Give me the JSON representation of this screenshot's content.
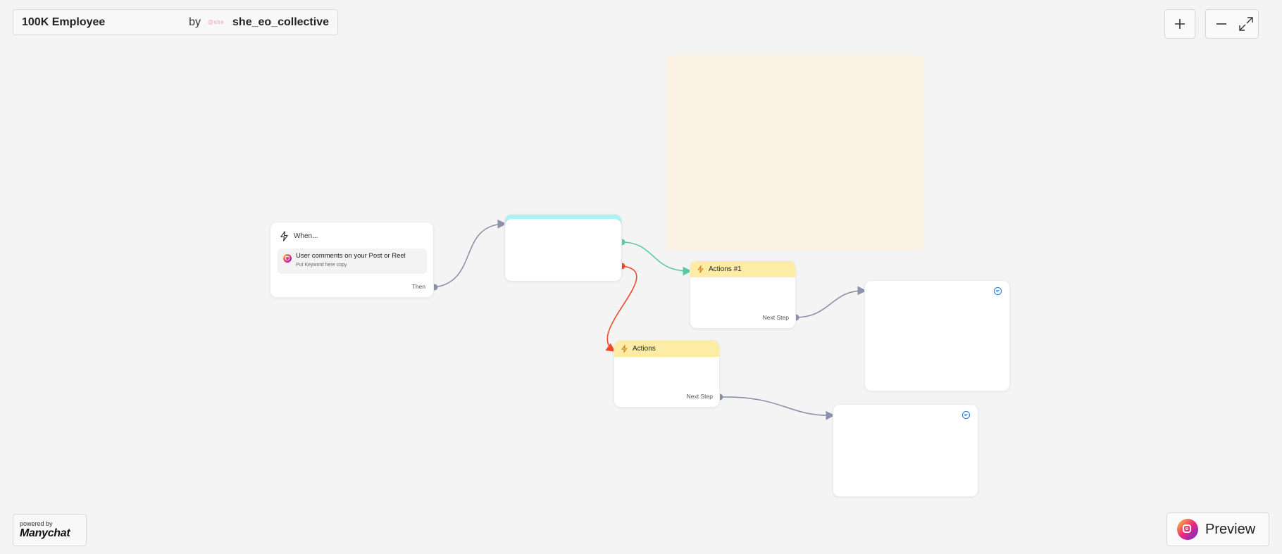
{
  "header": {
    "flow_name": "100K Employee",
    "by_label": "by",
    "creator_logo_text": "@she",
    "creator_name": "she_eo_collective"
  },
  "controls": {
    "zoom_in_icon": "plus-icon",
    "zoom_out_icon": "minus-icon",
    "expand_icon": "expand-icon"
  },
  "nodes": {
    "trigger": {
      "header": "When...",
      "item_title": "User comments on your Post or Reel",
      "item_subtitle": "Put Keyword here copy",
      "port_label": "Then"
    },
    "actions_primary": {
      "header": "Actions #1",
      "port_label": "Next Step"
    },
    "actions_secondary": {
      "header": "Actions",
      "port_label": "Next Step"
    }
  },
  "colors": {
    "edge_default": "#8a93a8",
    "edge_success": "#5ccaa0",
    "edge_fail": "#ee4b2b",
    "action_header": "#fdeca6",
    "condition_top": "#a9f4f2",
    "note_bg": "#fdf3e5"
  },
  "footer": {
    "powered_by": "powered by",
    "brand": "Manychat",
    "preview_label": "Preview"
  }
}
